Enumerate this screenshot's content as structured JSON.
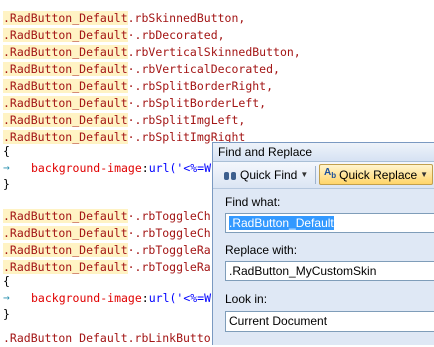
{
  "editor": {
    "lines": [
      {
        "a": ".RadButton_Default",
        "b": ".rbSkinnedButton,"
      },
      {
        "a": ".RadButton_Default",
        "b": "·.rbDecorated,"
      },
      {
        "a": ".RadButton_Default",
        "b": ".rbVerticalSkinnedButton,"
      },
      {
        "a": ".RadButton_Default",
        "b": "·.rbVerticalDecorated,"
      },
      {
        "a": ".RadButton_Default",
        "b": "·.rbSplitBorderRight,"
      },
      {
        "a": ".RadButton_Default",
        "b": "·.rbSplitBorderLeft,"
      },
      {
        "a": ".RadButton_Default",
        "b": "·.rbSplitImgLeft,"
      },
      {
        "a": ".RadButton_Default",
        "b": "·.rbSplitImgRight"
      }
    ],
    "brace_open": "{",
    "brace_close": "}",
    "prop1": "background-image",
    "colon1": ":",
    "url1": "url('<%=W",
    "lines2": [
      {
        "a": ".RadButton_Default",
        "b": "·.rbToggleCh"
      },
      {
        "a": ".RadButton_Default",
        "b": "·.rbToggleCh"
      },
      {
        "a": ".RadButton_Default",
        "b": "·.rbToggleRa"
      },
      {
        "a": ".RadButton_Default",
        "b": "·.rbToggleRa"
      }
    ],
    "prop2": "background-image",
    "url2": "url('<%=W",
    "last_line": ".RadButton Default.rbLinkButto"
  },
  "dialog": {
    "title": "Find and Replace",
    "quick_find": "Quick Find",
    "quick_replace": "Quick Replace",
    "find_what_label": "Find what:",
    "find_what_value": ".RadButton_Default",
    "replace_with_label": "Replace with:",
    "replace_with_value": ".RadButton_MyCustomSkin",
    "look_in_label": "Look in:",
    "look_in_value": "Current Document"
  }
}
